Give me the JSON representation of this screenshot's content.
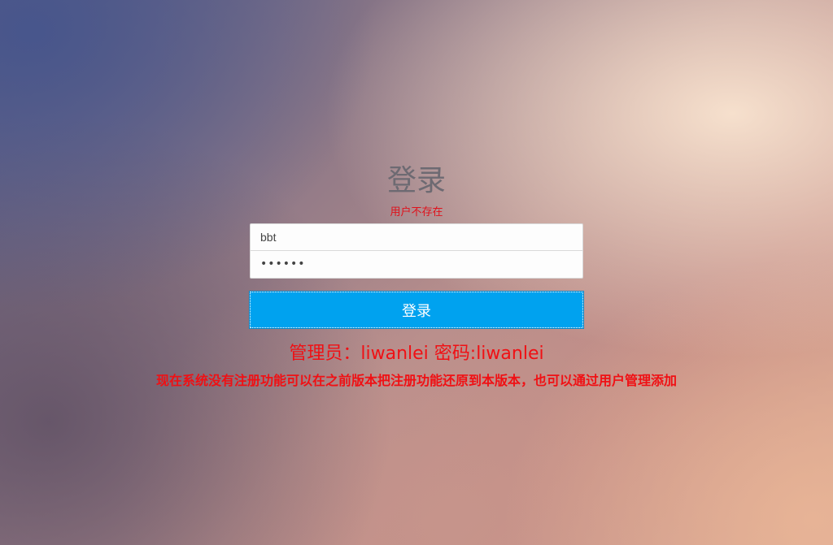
{
  "login": {
    "title": "登录",
    "error": "用户不存在",
    "username_value": "bbt",
    "password_mask": "••••••",
    "submit_label": "登录"
  },
  "info": {
    "admin": "管理员：liwanlei 密码:liwanlei",
    "notice": "现在系统没有注册功能可以在之前版本把注册功能还原到本版本，也可以通过用户管理添加"
  }
}
